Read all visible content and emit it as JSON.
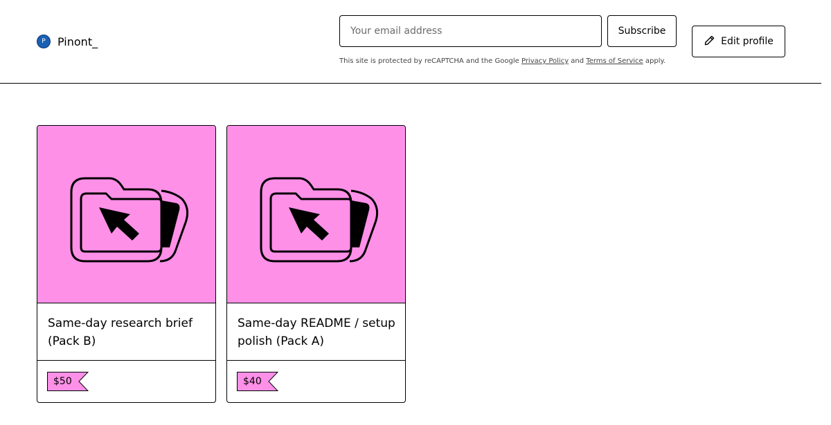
{
  "header": {
    "avatar_initial": "P",
    "brand_name": "Pinont_",
    "email_placeholder": "Your email address",
    "subscribe_label": "Subscribe",
    "edit_profile_label": "Edit profile",
    "recaptcha": {
      "prefix": "This site is protected by reCAPTCHA and the Google ",
      "privacy_link": "Privacy Policy",
      "middle": " and ",
      "terms_link": "Terms of Service",
      "suffix": " apply."
    }
  },
  "products": [
    {
      "title": "Same-day research brief (Pack B)",
      "price": "$50",
      "icon": "folder-cursor-icon"
    },
    {
      "title": "Same-day README / setup polish (Pack A)",
      "price": "$40",
      "icon": "folder-cursor-icon"
    }
  ],
  "colors": {
    "accent_pink": "#ff90e8",
    "avatar_blue": "#1a5fb4"
  }
}
